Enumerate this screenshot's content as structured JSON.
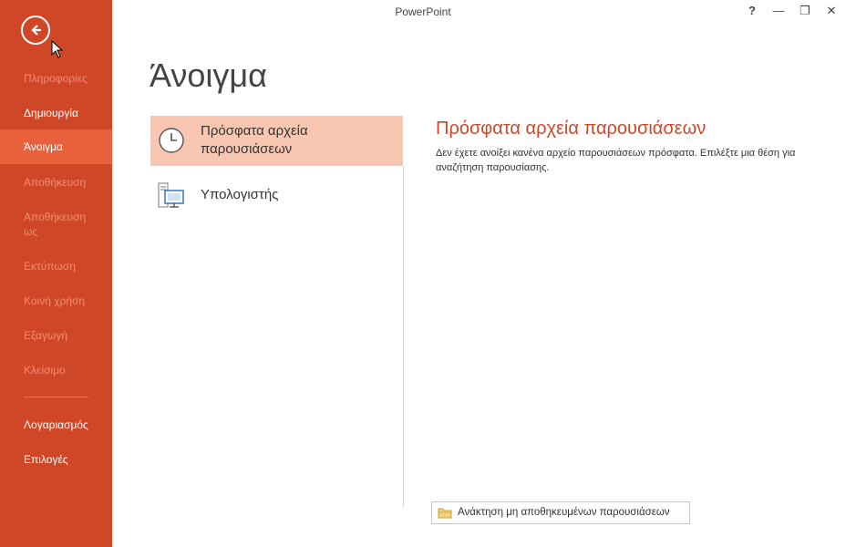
{
  "window": {
    "title": "PowerPoint",
    "help_glyph": "?",
    "minimize_glyph": "—",
    "restore_glyph": "❐",
    "close_glyph": "✕"
  },
  "sidebar": {
    "back_icon": "back-arrow-icon",
    "items": [
      {
        "label": "Πληροφορίες",
        "state": "disabled"
      },
      {
        "label": "Δημιουργία",
        "state": "enabled"
      },
      {
        "label": "Άνοιγμα",
        "state": "active"
      },
      {
        "label": "Αποθήκευση",
        "state": "disabled"
      },
      {
        "label": "Αποθήκευση ως",
        "state": "disabled"
      },
      {
        "label": "Εκτύπωση",
        "state": "disabled"
      },
      {
        "label": "Κοινή χρήση",
        "state": "disabled"
      },
      {
        "label": "Εξαγωγή",
        "state": "disabled"
      },
      {
        "label": "Κλείσιμο",
        "state": "disabled"
      },
      {
        "label": "Λογαριασμός",
        "state": "enabled"
      },
      {
        "label": "Επιλογές",
        "state": "enabled"
      }
    ]
  },
  "main": {
    "page_title": "Άνοιγμα",
    "locations": [
      {
        "label": "Πρόσφατα αρχεία παρουσιάσεων",
        "icon": "clock-icon",
        "selected": true
      },
      {
        "label": "Υπολογιστής",
        "icon": "computer-icon",
        "selected": false
      }
    ],
    "right_panel": {
      "title": "Πρόσφατα αρχεία παρουσιάσεων",
      "description": "Δεν έχετε ανοίξει κανένα αρχείο παρουσιάσεων πρόσφατα. Επιλέξτε μια θέση για αναζήτηση παρουσίασης."
    },
    "recover_button": {
      "label": "Ανάκτηση μη αποθηκευμένων παρουσιάσεων",
      "icon": "folder-icon"
    }
  },
  "colors": {
    "accent": "#d04727",
    "active_nav": "#e8613c",
    "selected_location": "#f9c6b2"
  }
}
